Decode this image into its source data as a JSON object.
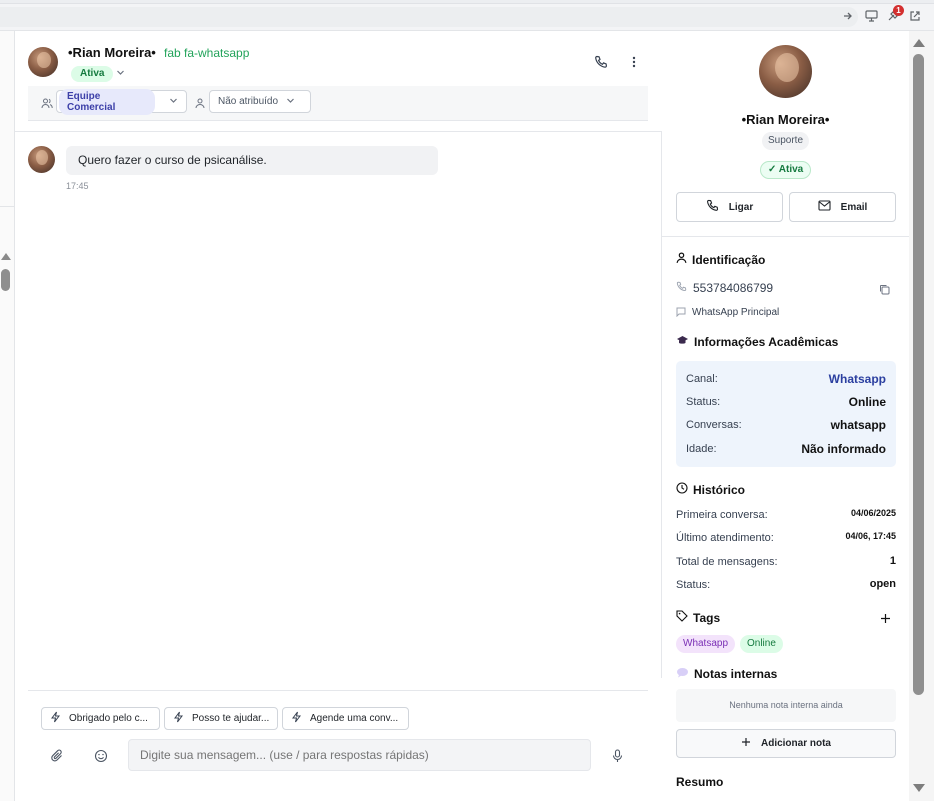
{
  "browser": {
    "notification_count": "1"
  },
  "chat": {
    "contact_name": "•Rian Moreira•",
    "channel_icon_text": "fab fa-whatsapp",
    "status": "Ativa",
    "team": "Equipe Comercial",
    "assignee": "Não atribuído",
    "messages": [
      {
        "text": "Quero fazer o curso de psicanálise.",
        "time": "17:45"
      }
    ],
    "quick_replies": [
      "Obrigado pelo c...",
      "Posso te ajudar...",
      "Agende uma conv..."
    ],
    "input_placeholder": "Digite sua mensagem... (use / para respostas rápidas)"
  },
  "panel": {
    "name": "•Rian Moreira•",
    "department": "Suporte",
    "status": "✓ Ativa",
    "call_label": "Ligar",
    "email_label": "Email",
    "identification": {
      "title": "Identificação",
      "phone": "553784086799",
      "channel": "WhatsApp Principal"
    },
    "academic": {
      "title": "Informações Acadêmicas",
      "rows": [
        {
          "label": "Canal:",
          "value": "Whatsapp"
        },
        {
          "label": "Status:",
          "value": "Online"
        },
        {
          "label": "Conversas:",
          "value": "whatsapp"
        },
        {
          "label": "Idade:",
          "value": "Não informado"
        }
      ]
    },
    "history": {
      "title": "Histórico",
      "rows": [
        {
          "label": "Primeira conversa:",
          "value": "04/06/2025"
        },
        {
          "label": "Último atendimento:",
          "value": "04/06, 17:45"
        },
        {
          "label": "Total de mensagens:",
          "value": "1"
        },
        {
          "label": "Status:",
          "value": "open"
        }
      ]
    },
    "tags": {
      "title": "Tags",
      "items": [
        "Whatsapp",
        "Online"
      ]
    },
    "notes": {
      "title": "Notas internas",
      "empty": "Nenhuma nota interna ainda",
      "add_label": "Adicionar nota"
    },
    "summary_title": "Resumo"
  },
  "colors": {
    "accent_green": "#22a35a",
    "link_blue": "#2b3fa0",
    "tag_purple": "#7a2fb5",
    "tag_green": "#157a3f"
  }
}
